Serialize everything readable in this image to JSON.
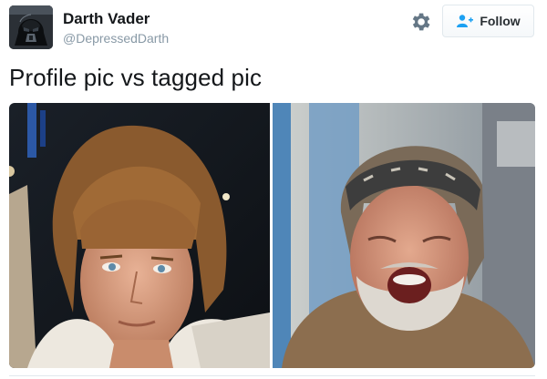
{
  "tweet": {
    "author": {
      "name": "Darth Vader",
      "handle": "@DepressedDarth",
      "avatar_icon": "darth-vader-helmet"
    },
    "text": "Profile pic vs tagged pic",
    "actions": {
      "settings_icon": "gear-icon",
      "follow_icon": "add-user-icon",
      "follow_label": "Follow"
    },
    "media": [
      {
        "description_kind": "photo",
        "subject": "young man with brown feathered hair in white robe"
      },
      {
        "description_kind": "photo",
        "subject": "older bearded man with bandana laughing"
      }
    ]
  },
  "colors": {
    "name": "#14171a",
    "handle": "#8899a6",
    "icon": "#657786",
    "follow_accent": "#1da1f2",
    "border": "#e1e8ed"
  }
}
